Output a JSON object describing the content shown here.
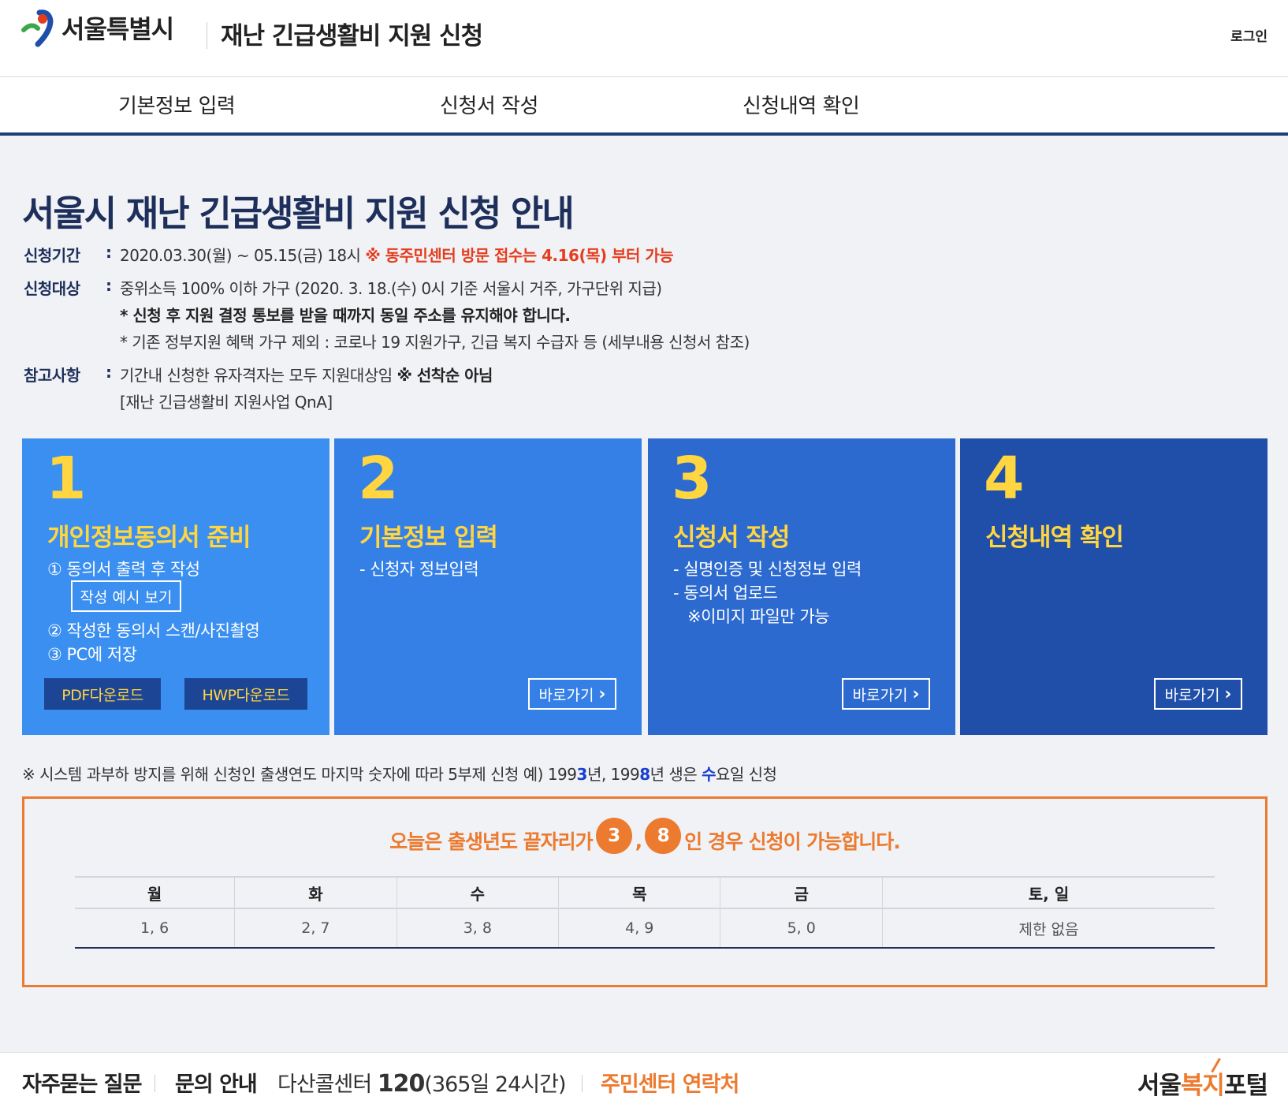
{
  "header": {
    "logo_text": "서울특별시",
    "title": "재난 긴급생활비 지원 신청",
    "login": "로그인"
  },
  "nav": {
    "items": [
      {
        "label": "기본정보 입력"
      },
      {
        "label": "신청서 작성"
      },
      {
        "label": "신청내역 확인"
      }
    ]
  },
  "main": {
    "title": "서울시 재난 긴급생활비 지원 신청 안내",
    "period": {
      "label": "신청기간",
      "value": "2020.03.30(월) ~ 05.15(금) 18시",
      "highlight": "※ 동주민센터 방문 접수는 4.16(목) 부터 가능"
    },
    "target": {
      "label": "신청대상",
      "line1": "중위소득 100% 이하 가구 (2020. 3. 18.(수) 0시 기준 서울시 거주, 가구단위 지급)",
      "line2": "* 신청 후 지원 결정 통보를 받을 때까지 동일 주소를 유지해야 합니다.",
      "line3": "* 기존 정부지원 혜택 가구 제외 : 코로나 19 지원가구, 긴급 복지 수급자 등 (세부내용 신청서 참조)"
    },
    "notes": {
      "label": "참고사항",
      "line1": "기간내 신청한 유자격자는 모두 지원대상임",
      "line1_bold": "※ 선착순 아님",
      "line2": "[재난 긴급생활비 지원사업 QnA]"
    },
    "colon": ":"
  },
  "steps": [
    {
      "num": "1",
      "title": "개인정보동의서 준비",
      "desc1": "① 동의서 출력 후 작성",
      "example_btn": "작성 예시 보기",
      "desc2": "② 작성한 동의서 스캔/사진촬영",
      "desc3": "③ PC에 저장",
      "pdf_btn": "PDF다운로드",
      "hwp_btn": "HWP다운로드",
      "color": "#3a8ff0"
    },
    {
      "num": "2",
      "title": "기본정보 입력",
      "desc1": "- 신청자 정보입력",
      "go_btn": "바로가기",
      "color": "#3580e6"
    },
    {
      "num": "3",
      "title": "신청서 작성",
      "desc1": "- 실명인증 및 신청정보 입력",
      "desc2": "- 동의서 업로드",
      "desc3": "※이미지 파일만 가능",
      "go_btn": "바로가기",
      "color": "#2d6ad0"
    },
    {
      "num": "4",
      "title": "신청내역 확인",
      "go_btn": "바로가기",
      "color": "#1f4fa8"
    }
  ],
  "notice": {
    "text1": "※ 시스템 과부하 방지를 위해 신청인 출생연도 마지막 숫자에 따라 5부제 신청 예) 199",
    "d1": "3",
    "text2": "년, 199",
    "d2": "8",
    "text3": "년 생은 ",
    "day": "수",
    "text4": "요일 신청"
  },
  "schedule": {
    "today_prefix": "오늘은 출생년도 끝자리가",
    "digit1": "3",
    "comma": ",",
    "digit2": "8",
    "today_suffix": "인 경우 신청이 가능합니다.",
    "headers": [
      "월",
      "화",
      "수",
      "목",
      "금",
      "토, 일"
    ],
    "values": [
      "1, 6",
      "2, 7",
      "3, 8",
      "4, 9",
      "5, 0",
      "제한 없음"
    ]
  },
  "footer": {
    "faq": "자주묻는 질문",
    "inquiry": "문의 안내",
    "dasan": "다산콜센터",
    "number": "120",
    "hours": "(365일 24시간)",
    "center": "주민센터 연락처",
    "logo_a": "서울",
    "logo_b": "복지",
    "logo_c": "포털"
  },
  "colors": {
    "accent_orange": "#ec7a2f",
    "navy": "#1d2f5a",
    "yellow": "#ffd540",
    "red": "#e63c1e"
  }
}
